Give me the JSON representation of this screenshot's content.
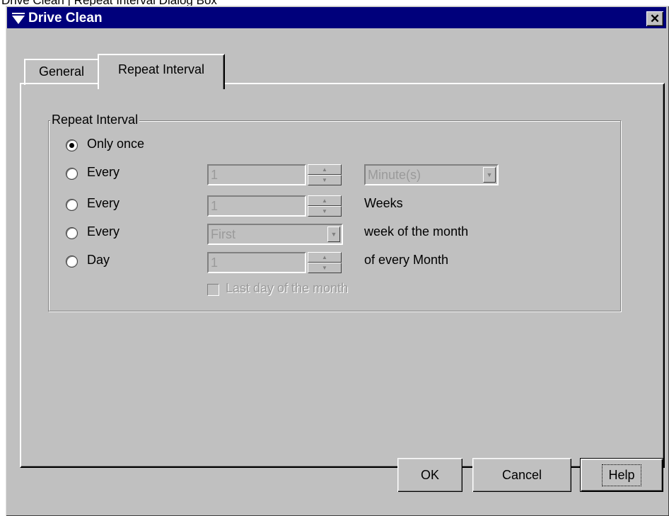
{
  "caption": "Drive Clean | Repeat Interval Dialog Box",
  "window": {
    "title": "Drive Clean",
    "close_label": "✕"
  },
  "tabs": [
    {
      "label": "General",
      "active": false
    },
    {
      "label": "Repeat Interval",
      "active": true
    }
  ],
  "group": {
    "label": "Repeat Interval",
    "rows": [
      {
        "radio_label": "Only once",
        "checked": true
      },
      {
        "radio_label": "Every",
        "spin_value": "1",
        "combo_value": "Minute(s)"
      },
      {
        "radio_label": "Every",
        "spin_value": "1",
        "suffix": "Weeks"
      },
      {
        "radio_label": "Every",
        "combo_value": "First",
        "suffix": "week of the month"
      },
      {
        "radio_label": "Day",
        "spin_value": "1",
        "suffix": "of every Month"
      }
    ],
    "last_day_label": "Last day of the month"
  },
  "buttons": {
    "ok": "OK",
    "cancel": "Cancel",
    "help": "Help"
  },
  "glyphs": {
    "spin_up": "▲",
    "spin_down": "▼",
    "combo_arrow": "▼"
  },
  "colors": {
    "titlebar": "#00007b",
    "dialog_bg": "#c0c0c0",
    "disabled_text": "#9a9a9a"
  }
}
